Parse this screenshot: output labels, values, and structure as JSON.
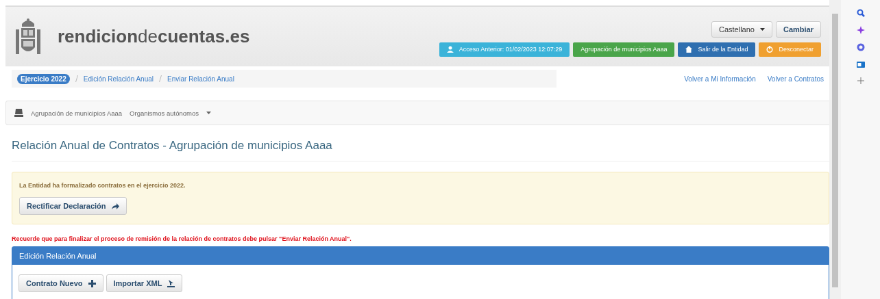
{
  "header": {
    "brand": "**rendicion**de**cuentas.es**",
    "language": {
      "value": "Castellano"
    },
    "change_button": "Cambiar",
    "badges": [
      {
        "kind": "user",
        "label": "Acceso Anterior: 01/02/2023 12:07:29",
        "color": "#3bb3d9"
      },
      {
        "kind": "none",
        "label": "Agrupación de municipios Aaaa",
        "color": "#4aa54a"
      },
      {
        "kind": "home",
        "label": "Salir de la Entidad",
        "color": "#2f6fb0"
      },
      {
        "kind": "power",
        "label": "Desconectar",
        "color": "#f0a030"
      }
    ]
  },
  "breadcrumb": {
    "year_badge": "Ejercicio 2022",
    "items": [
      "Edición Relación Anual",
      "Enviar Relación Anual"
    ]
  },
  "top_links": [
    "Volver a Mi Información",
    "Volver a Contratos"
  ],
  "navbar": {
    "entity": "Agrupación de municipios Aaaa",
    "dropdown": "Organismos autónomos"
  },
  "page_title": "Relación Anual de Contratos - Agrupación de municipios Aaaa",
  "alert": {
    "message": "La Entidad ha formalizado contratos en el ejercicio 2022.",
    "button": "Rectificar Declaración"
  },
  "reminder": "Recuerde que para finalizar el proceso de remisión de la relación de contratos debe pulsar \"Enviar Relación Anual\".",
  "panel": {
    "title": "Edición Relación Anual",
    "buttons": [
      {
        "kind": "plus",
        "label": "Contrato Nuevo"
      },
      {
        "kind": "import",
        "label": "Importar XML"
      }
    ]
  }
}
